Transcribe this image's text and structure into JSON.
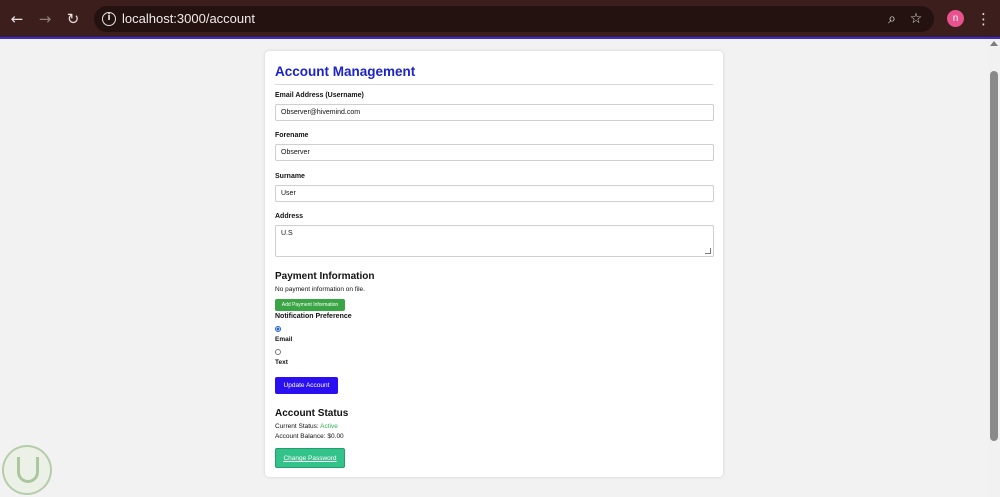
{
  "browser": {
    "url": "localhost:3000/account",
    "profile_initial": "n",
    "icons": {
      "back": "back-arrow-icon",
      "forward": "forward-arrow-icon",
      "reload": "reload-icon",
      "info": "info-icon",
      "zoom": "zoom-icon",
      "bookmark": "star-icon",
      "menu": "three-dots-icon"
    }
  },
  "page": {
    "title": "Account Management",
    "email": {
      "label": "Email Address (Username)",
      "value": "Observer@hivemind.com"
    },
    "forename": {
      "label": "Forename",
      "value": "Observer"
    },
    "surname": {
      "label": "Surname",
      "value": "User"
    },
    "address": {
      "label": "Address",
      "value": "U.S"
    },
    "payment": {
      "heading": "Payment Information",
      "note": "No payment information on file.",
      "add_button": "Add Payment Information"
    },
    "notification": {
      "heading": "Notification Preference",
      "options": [
        {
          "label": "Email",
          "checked": true
        },
        {
          "label": "Text",
          "checked": false
        }
      ]
    },
    "update_button": "Update Account",
    "status": {
      "heading": "Account Status",
      "current_label": "Current Status:",
      "current_value": "Active",
      "balance_label": "Account Balance:",
      "balance_value": "$0.00",
      "change_password_button": "Change Password"
    }
  },
  "colors": {
    "title": "#1c22c9",
    "add_payment_button": "#3aa545",
    "update_button": "#2a0ff0",
    "change_password_button": "#33c28a",
    "active_status": "#2fb24b"
  }
}
